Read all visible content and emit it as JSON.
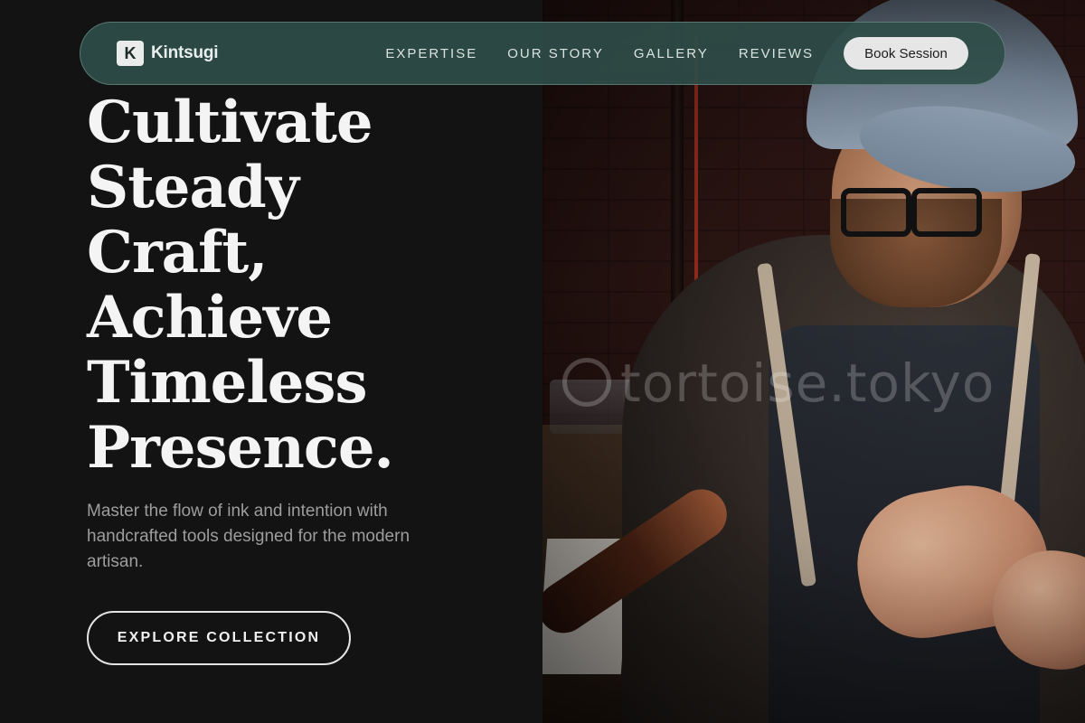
{
  "nav": {
    "brand": {
      "mark": "K",
      "name": "Kintsugi"
    },
    "links": [
      {
        "label": "EXPERTISE"
      },
      {
        "label": "OUR STORY"
      },
      {
        "label": "GALLERY"
      },
      {
        "label": "REVIEWS"
      }
    ],
    "cta_label": "Book Session"
  },
  "hero": {
    "headline_lines": [
      "Cultivate",
      "Steady",
      "Craft,",
      "Achieve",
      "Timeless",
      "Presence."
    ],
    "subtitle": "Master the flow of ink and intention with handcrafted tools designed for the modern artisan.",
    "cta_label": "EXPLORE COLLECTION"
  },
  "photo": {
    "watermark": "tortoise.tokyo",
    "subject": "artisan wearing cap and glasses working with a handcrafted tool"
  },
  "colors": {
    "background": "#131313",
    "nav_background": "#2f4d49",
    "nav_text": "#d9e2df",
    "headline": "#f4f4f4",
    "subtitle": "#9d9d9d",
    "button_light": "#e6e6e6"
  }
}
